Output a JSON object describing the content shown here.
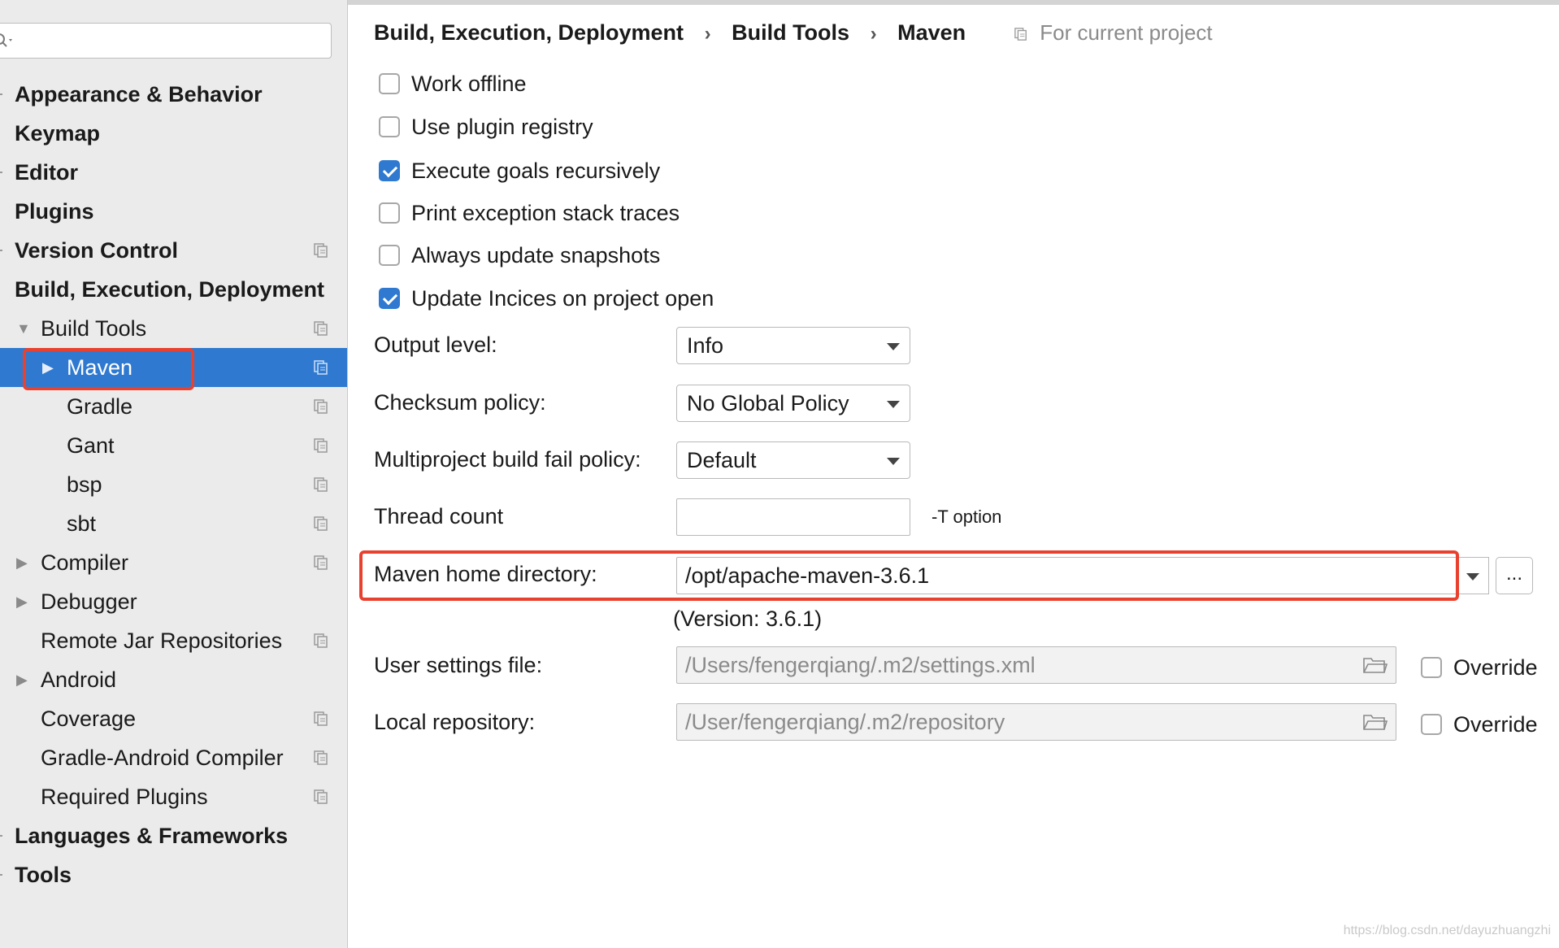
{
  "search": {
    "value": ""
  },
  "sidebar": {
    "items": [
      {
        "label": "Appearance & Behavior"
      },
      {
        "label": "Keymap"
      },
      {
        "label": "Editor"
      },
      {
        "label": "Plugins"
      },
      {
        "label": "Version Control"
      },
      {
        "label": "Build, Execution, Deployment"
      },
      {
        "label": "Build Tools"
      },
      {
        "label": "Maven"
      },
      {
        "label": "Gradle"
      },
      {
        "label": "Gant"
      },
      {
        "label": "bsp"
      },
      {
        "label": "sbt"
      },
      {
        "label": "Compiler"
      },
      {
        "label": "Debugger"
      },
      {
        "label": "Remote Jar Repositories"
      },
      {
        "label": "Android"
      },
      {
        "label": "Coverage"
      },
      {
        "label": "Gradle-Android Compiler"
      },
      {
        "label": "Required Plugins"
      },
      {
        "label": "Languages & Frameworks"
      },
      {
        "label": "Tools"
      }
    ]
  },
  "breadcrumb": {
    "items": [
      "Build, Execution, Deployment",
      "Build Tools",
      "Maven"
    ],
    "separator": "›",
    "scope_label": "For current project"
  },
  "options": {
    "work_offline": {
      "label": "Work offline",
      "checked": false
    },
    "use_plugin_registry": {
      "label": "Use plugin registry",
      "checked": false
    },
    "execute_goals_recursively": {
      "label": "Execute goals recursively",
      "checked": true
    },
    "print_exception_stack_traces": {
      "label": "Print exception stack traces",
      "checked": false
    },
    "always_update_snapshots": {
      "label": "Always update snapshots",
      "checked": false
    },
    "update_indices": {
      "label": "Update Incices on project open",
      "checked": true
    }
  },
  "fields": {
    "output_level": {
      "label": "Output level:",
      "value": "Info"
    },
    "checksum_policy": {
      "label": "Checksum policy:",
      "value": "No Global Policy"
    },
    "multiproject_policy": {
      "label": "Multiproject build fail policy:",
      "value": "Default"
    },
    "thread_count": {
      "label": "Thread count",
      "value": "",
      "hint": "-T option"
    },
    "maven_home": {
      "label": "Maven home directory:",
      "value": "/opt/apache-maven-3.6.1",
      "version": "(Version: 3.6.1)",
      "browse_label": "..."
    },
    "user_settings": {
      "label": "User settings file:",
      "value": "/Users/fengerqiang/.m2/settings.xml",
      "override_label": "Override",
      "override_checked": false
    },
    "local_repository": {
      "label": "Local repository:",
      "value": "/User/fengerqiang/.m2/repository",
      "override_label": "Override",
      "override_checked": false
    }
  },
  "watermark": "https://blog.csdn.net/dayuzhuangzhi",
  "colors": {
    "selection": "#2f7ad0",
    "highlight_box": "#e8412f",
    "sidebar_bg": "#ebebeb"
  },
  "icons": [
    "search-icon",
    "chevron-right-icon",
    "chevron-down-icon",
    "project-scope-icon",
    "folder-icon",
    "dropdown-caret-icon"
  ]
}
